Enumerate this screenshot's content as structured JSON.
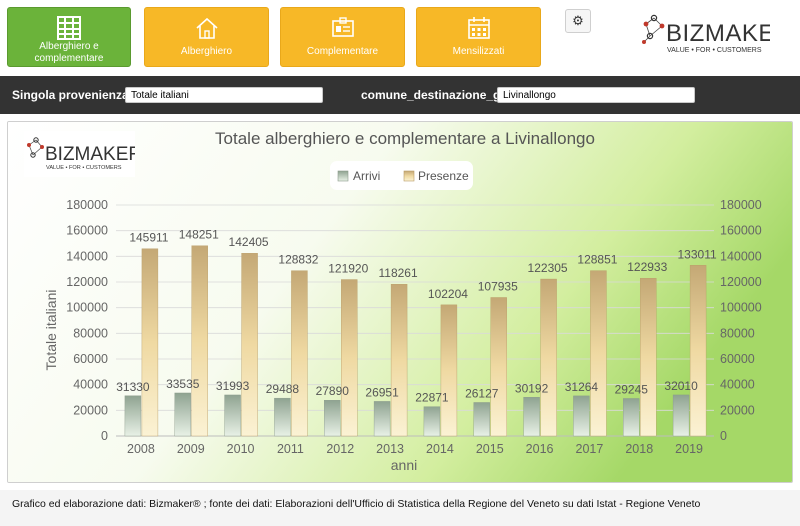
{
  "nav": {
    "buttons": [
      {
        "label": "Alberghiero e complementare",
        "icon": "grid-table-icon",
        "active": true
      },
      {
        "label": "Alberghiero",
        "icon": "house-icon"
      },
      {
        "label": "Complementare",
        "icon": "id-card-icon"
      },
      {
        "label": "Mensilizzati",
        "icon": "calendar-icon"
      }
    ],
    "settings_icon": "gear-icon"
  },
  "brand": {
    "name": "BIZMAKER",
    "tagline": "VALUE • FOR • CUSTOMERS"
  },
  "filters": {
    "provenienza_label": "Singola provenienza:",
    "provenienza_value": "Totale italiani",
    "comune_label": "comune_destinazione_g",
    "comune_value": "Livinallongo"
  },
  "colors": {
    "green": "#6bb33a",
    "yellow": "#f7b827",
    "filter_bg": "#333333"
  },
  "chart_data": {
    "type": "bar",
    "title": "Totale alberghiero e complementare a Livinallongo",
    "xlabel": "anni",
    "ylabel": "Totale italiani",
    "categories": [
      "2008",
      "2009",
      "2010",
      "2011",
      "2012",
      "2013",
      "2014",
      "2015",
      "2016",
      "2017",
      "2018",
      "2019"
    ],
    "series": [
      {
        "name": "Arrivi",
        "values": [
          31330,
          33535,
          31993,
          29488,
          27890,
          26951,
          22871,
          26127,
          30192,
          31264,
          29245,
          32010
        ]
      },
      {
        "name": "Presenze",
        "values": [
          145911,
          148251,
          142405,
          128832,
          121920,
          118261,
          102204,
          107935,
          122305,
          128851,
          122933,
          133011
        ]
      }
    ],
    "ylim": [
      0,
      180000
    ],
    "yticks": [
      "0",
      "20000",
      "40000",
      "60000",
      "80000",
      "100000",
      "120000",
      "140000",
      "160000",
      "180000"
    ],
    "grid": true,
    "legend": "top-center",
    "data_labels": [
      "31330",
      "33535",
      "31993",
      "29488",
      "27890",
      "26951",
      "22871",
      "26127",
      "30192",
      "31264",
      "29245",
      "32010",
      "145911",
      "148251",
      "142405",
      "128832",
      "121920",
      "118261",
      "102204",
      "107935",
      "122305",
      "128851",
      "122933",
      "133011"
    ]
  },
  "footer": {
    "text": "Grafico ed elaborazione dati: Bizmaker® ; fonte dei dati: Elaborazioni dell'Ufficio di Statistica della Regione del Veneto  su dati Istat - Regione Veneto"
  }
}
